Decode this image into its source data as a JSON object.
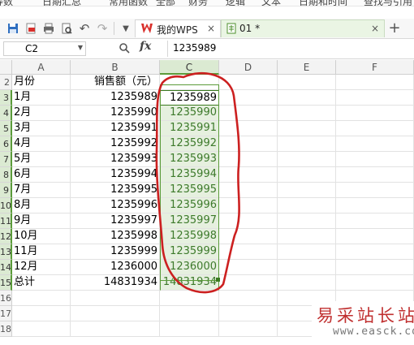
{
  "menu": [
    "等数",
    "日期汇总",
    "常用函数",
    "全部",
    "财务",
    "逻辑",
    "文本",
    "日期和时间",
    "查找与引用"
  ],
  "tabs": [
    {
      "label": "我的WPS",
      "close": "×"
    },
    {
      "label": "01 *",
      "close": "×"
    }
  ],
  "new_tab": "+",
  "name_box": "C2",
  "fx_label": "fx",
  "formula": "1235989",
  "columns": [
    "A",
    "B",
    "C",
    "D",
    "E",
    "F"
  ],
  "rows": [
    "2",
    "3",
    "4",
    "5",
    "6",
    "7",
    "8",
    "9",
    "10",
    "11",
    "12",
    "13",
    "14",
    "15",
    "16",
    "17",
    "18"
  ],
  "header_row": {
    "a": "月份",
    "b": "销售额（元）"
  },
  "data_rows": [
    {
      "a": "1月",
      "b": "1235989",
      "c": "1235989"
    },
    {
      "a": "2月",
      "b": "1235990",
      "c": "1235990"
    },
    {
      "a": "3月",
      "b": "1235991",
      "c": "1235991"
    },
    {
      "a": "4月",
      "b": "1235992",
      "c": "1235992"
    },
    {
      "a": "5月",
      "b": "1235993",
      "c": "1235993"
    },
    {
      "a": "6月",
      "b": "1235994",
      "c": "1235994"
    },
    {
      "a": "7月",
      "b": "1235995",
      "c": "1235995"
    },
    {
      "a": "8月",
      "b": "1235996",
      "c": "1235996"
    },
    {
      "a": "9月",
      "b": "1235997",
      "c": "1235997"
    },
    {
      "a": "10月",
      "b": "1235998",
      "c": "1235998"
    },
    {
      "a": "11月",
      "b": "1235999",
      "c": "1235999"
    },
    {
      "a": "12月",
      "b": "1236000",
      "c": "1236000"
    },
    {
      "a": "总计",
      "b": "14831934",
      "c": "14831934"
    }
  ],
  "watermark": {
    "title": "易采站长站",
    "url": "www.easck.com"
  },
  "colors": {
    "selection": "#5b9b3a",
    "annotation": "#cc2020",
    "wps_red": "#d9302c"
  }
}
